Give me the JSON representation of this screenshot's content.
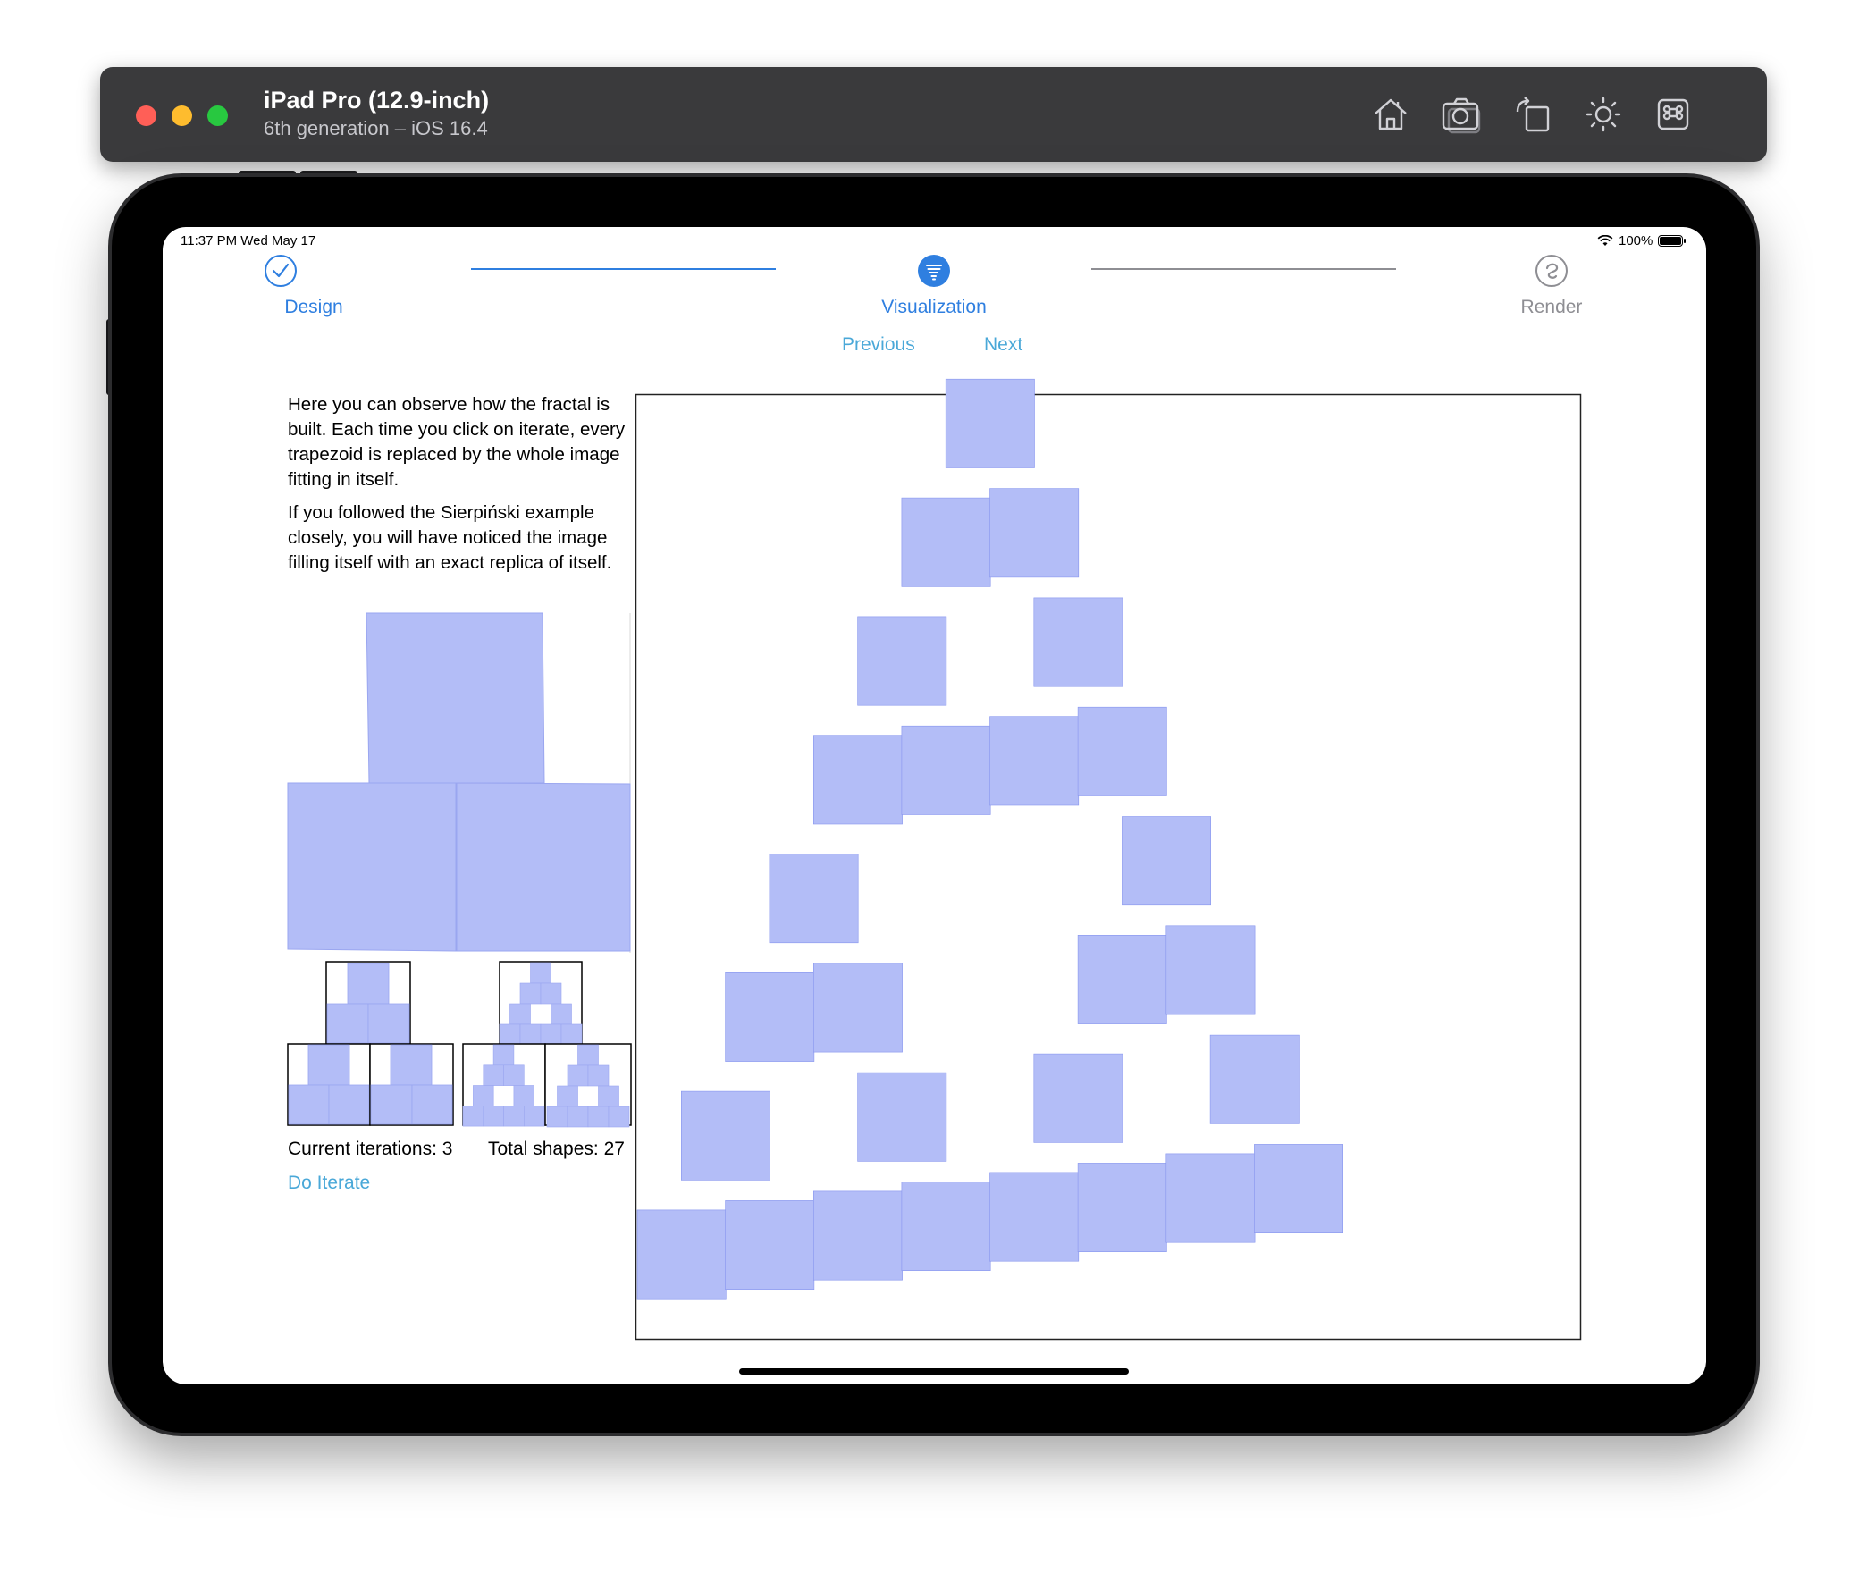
{
  "simulator": {
    "device_name": "iPad Pro (12.9-inch)",
    "device_os": "6th generation – iOS 16.4",
    "toolbar_icons": [
      "home-icon",
      "screenshot-icon",
      "rotate-icon",
      "appearance-icon",
      "command-icon"
    ]
  },
  "status_bar": {
    "time_date": "11:37 PM   Wed May 17",
    "battery": "100%"
  },
  "stepper": {
    "steps": [
      {
        "label": "Design",
        "state": "completed",
        "icon": "checkmark-circle-icon"
      },
      {
        "label": "Visualization",
        "state": "current",
        "icon": "tornado-icon"
      },
      {
        "label": "Render",
        "state": "upcoming",
        "icon": "spiral-icon"
      }
    ],
    "previous": "Previous",
    "next": "Next"
  },
  "intro": {
    "paragraph1": "Here you can observe how the fractal is built. Each time you click on iterate, every trapezoid is replaced by the whole image fitting in itself.",
    "paragraph2": "If you followed the Sierpiński example closely, you will have noticed the image filling itself with an exact replica of itself."
  },
  "stats": {
    "current_iterations": "Current iterations: 3",
    "total_shapes": "Total shapes: 27"
  },
  "actions": {
    "do_iterate": "Do Iterate"
  },
  "colors": {
    "accent": "#2f7fe0",
    "link": "#4aa8d8",
    "shape_fill": "#b3bdf7",
    "shape_overlap": "#8795ee",
    "inactive": "#8e8e93"
  }
}
